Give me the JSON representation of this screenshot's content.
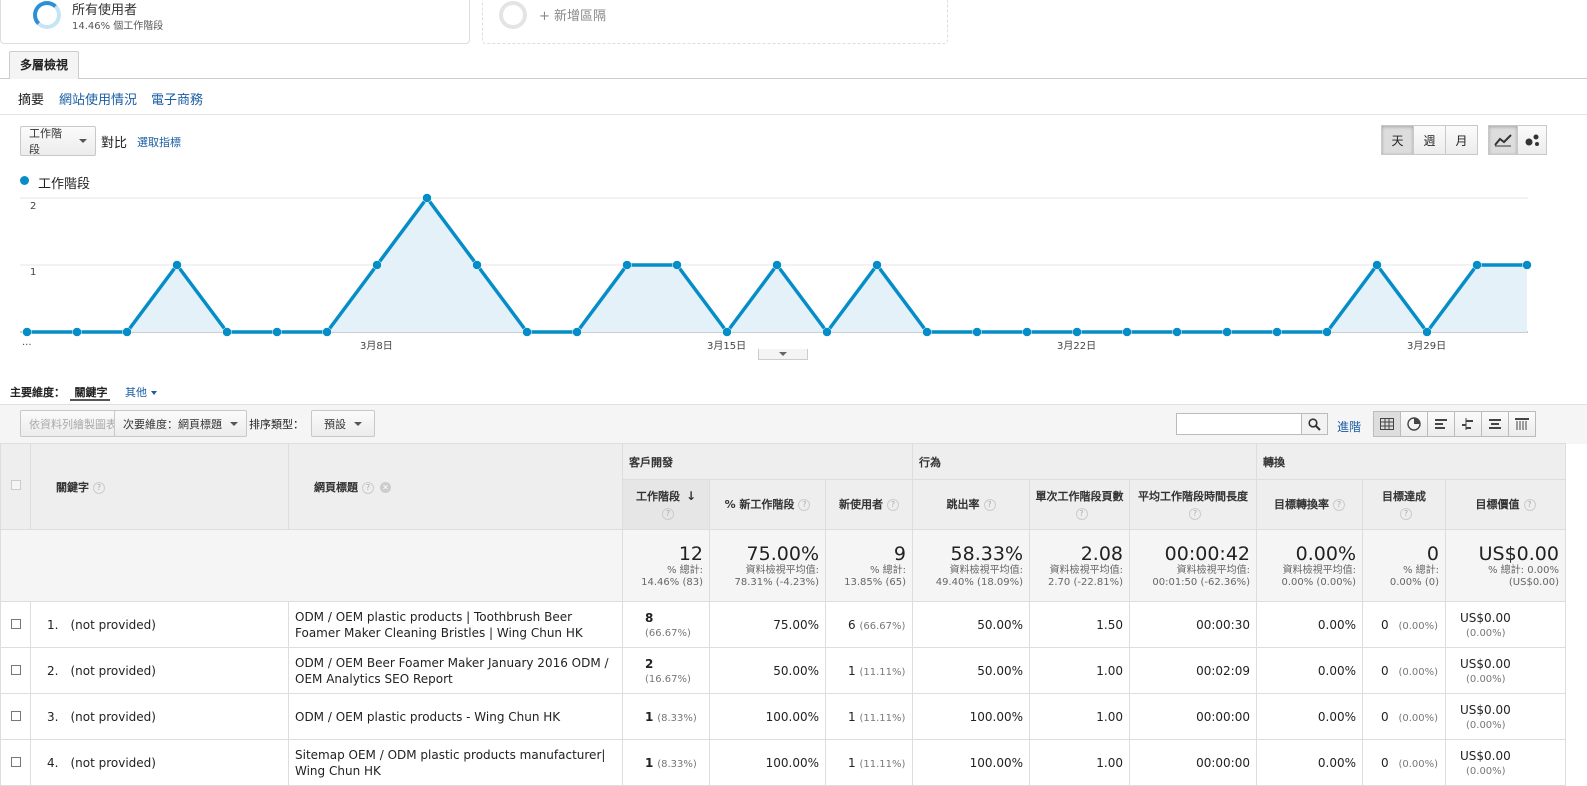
{
  "segments": [
    {
      "title": "所有使用者",
      "subtitle": "14.46% 個工作階段"
    },
    {
      "title": "+ 新增區隔"
    }
  ],
  "tab": "多層檢視",
  "subnav": {
    "summary": "摘要",
    "site_usage": "網站使用情況",
    "ecommerce": "電子商務"
  },
  "metric_select": "工作階段",
  "compare_label": "對比",
  "select_metric_link": "選取指標",
  "period_buttons": [
    "天",
    "週",
    "月"
  ],
  "legend": "工作階段",
  "chart_data": {
    "type": "area",
    "series": [
      {
        "name": "工作階段",
        "values": [
          0,
          0,
          0,
          1,
          0,
          0,
          0,
          1,
          2,
          1,
          0,
          0,
          1,
          1,
          0,
          1,
          0,
          1,
          0,
          0,
          0,
          0,
          0,
          0,
          0,
          0,
          0,
          1,
          0,
          1,
          1
        ]
      }
    ],
    "x_tick_labels": [
      "...",
      "3月8日",
      "3月15日",
      "3月22日",
      "3月29日"
    ],
    "y_tick_labels": [
      "1",
      "2"
    ],
    "ylim": [
      0,
      2
    ],
    "grid": true,
    "color": "#058dc7"
  },
  "dimension": {
    "label": "主要維度：",
    "primary": "關鍵字",
    "other": "其他"
  },
  "toolbar": {
    "plot_rows": "依資料列繪製圖表",
    "secondary": "次要維度：網頁標題",
    "sort_label": "排序類型：",
    "sort_value": "預設",
    "advanced": "進階"
  },
  "table": {
    "groups": {
      "acquisition": "客戶開發",
      "behavior": "行為",
      "conversions": "轉換"
    },
    "headers": {
      "keyword": "關鍵字",
      "page_title": "網頁標題",
      "sessions": "工作階段",
      "new_sessions": "% 新工作階段",
      "new_users": "新使用者",
      "bounce": "跳出率",
      "pages": "單次工作階段頁數",
      "duration": "平均工作階段時間長度",
      "goal_rate": "目標轉換率",
      "goal_comp": "目標達成",
      "goal_value": "目標價值"
    },
    "totals": {
      "sessions": "12",
      "sessions_sub1": "% 總計:",
      "sessions_sub2": "14.46% (83)",
      "new_sessions": "75.00%",
      "new_sessions_sub1": "資料檢視平均值:",
      "new_sessions_sub2": "78.31% (-4.23%)",
      "new_users": "9",
      "new_users_sub1": "% 總計:",
      "new_users_sub2": "13.85% (65)",
      "bounce": "58.33%",
      "bounce_sub1": "資料檢視平均值:",
      "bounce_sub2": "49.40% (18.09%)",
      "pages": "2.08",
      "pages_sub1": "資料檢視平均值:",
      "pages_sub2": "2.70 (-22.81%)",
      "duration": "00:00:42",
      "duration_sub1": "資料檢視平均值:",
      "duration_sub2": "00:01:50 (-62.36%)",
      "goal_rate": "0.00%",
      "goal_rate_sub1": "資料檢視平均值:",
      "goal_rate_sub2": "0.00% (0.00%)",
      "goal_comp": "0",
      "goal_comp_sub1": "% 總計:",
      "goal_comp_sub2": "0.00% (0)",
      "goal_value": "US$0.00",
      "goal_value_sub1": "% 總計: 0.00%",
      "goal_value_sub2": "(US$0.00)"
    },
    "rows": [
      {
        "idx": "1.",
        "keyword": "(not provided)",
        "page": "ODM / OEM plastic products | Toothbrush Beer Foamer Maker Cleaning Bristles | Wing Chun HK",
        "sessions": "8",
        "sessions_pct": "(66.67%)",
        "new_sessions": "75.00%",
        "new_users": "6",
        "new_users_pct": "(66.67%)",
        "bounce": "50.00%",
        "pages": "1.50",
        "duration": "00:00:30",
        "goal_rate": "0.00%",
        "goal_comp": "0",
        "goal_comp_pct": "(0.00%)",
        "goal_value": "US$0.00",
        "goal_value_pct": "(0.00%)"
      },
      {
        "idx": "2.",
        "keyword": "(not provided)",
        "page": "ODM / OEM Beer Foamer Maker January 2016 ODM / OEM Analytics SEO Report",
        "sessions": "2",
        "sessions_pct": "(16.67%)",
        "new_sessions": "50.00%",
        "new_users": "1",
        "new_users_pct": "(11.11%)",
        "bounce": "50.00%",
        "pages": "1.00",
        "duration": "00:02:09",
        "goal_rate": "0.00%",
        "goal_comp": "0",
        "goal_comp_pct": "(0.00%)",
        "goal_value": "US$0.00",
        "goal_value_pct": "(0.00%)"
      },
      {
        "idx": "3.",
        "keyword": "(not provided)",
        "page": "ODM / OEM plastic products - Wing Chun HK",
        "sessions": "1",
        "sessions_pct": "(8.33%)",
        "new_sessions": "100.00%",
        "new_users": "1",
        "new_users_pct": "(11.11%)",
        "bounce": "100.00%",
        "pages": "1.00",
        "duration": "00:00:00",
        "goal_rate": "0.00%",
        "goal_comp": "0",
        "goal_comp_pct": "(0.00%)",
        "goal_value": "US$0.00",
        "goal_value_pct": "(0.00%)"
      },
      {
        "idx": "4.",
        "keyword": "(not provided)",
        "page": "Sitemap OEM / ODM plastic products manufacturer| Wing Chun HK",
        "sessions": "1",
        "sessions_pct": "(8.33%)",
        "new_sessions": "100.00%",
        "new_users": "1",
        "new_users_pct": "(11.11%)",
        "bounce": "100.00%",
        "pages": "1.00",
        "duration": "00:00:00",
        "goal_rate": "0.00%",
        "goal_comp": "0",
        "goal_comp_pct": "(0.00%)",
        "goal_value": "US$0.00",
        "goal_value_pct": "(0.00%)"
      }
    ]
  }
}
